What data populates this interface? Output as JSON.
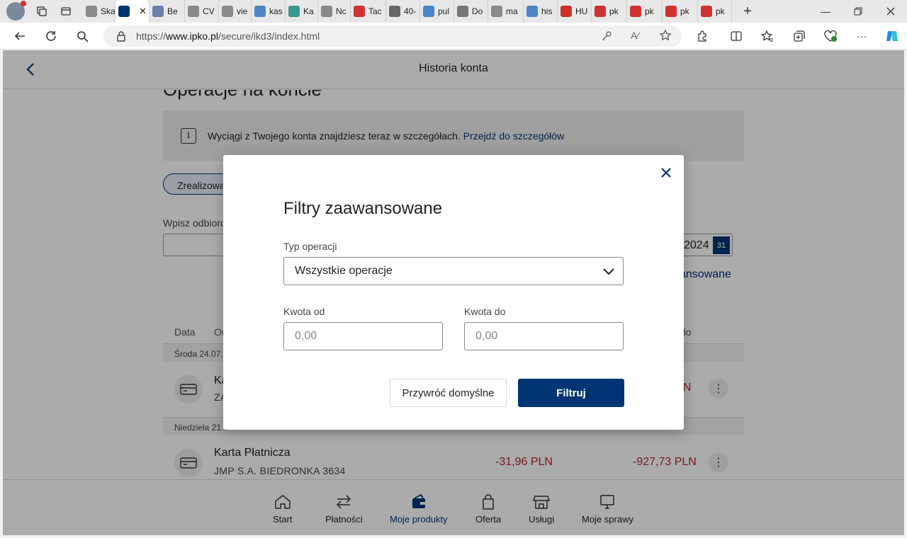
{
  "browser": {
    "tabs": [
      {
        "label": "Ska",
        "color": "#8a8a8a"
      },
      {
        "label": "",
        "color": "#003574",
        "active": true
      },
      {
        "label": "Be",
        "color": "#6a7fa8"
      },
      {
        "label": "CV",
        "color": "#8a8a8a"
      },
      {
        "label": "vie",
        "color": "#8a8a8a"
      },
      {
        "label": "kas",
        "color": "#4a86c8"
      },
      {
        "label": "Ka",
        "color": "#3a9a8a"
      },
      {
        "label": "Nc",
        "color": "#8a8a8a"
      },
      {
        "label": "Tac",
        "color": "#d0302f"
      },
      {
        "label": "40-",
        "color": "#666666"
      },
      {
        "label": "pul",
        "color": "#4a86c8"
      },
      {
        "label": "Do",
        "color": "#777777"
      },
      {
        "label": "ma",
        "color": "#8a8a8a"
      },
      {
        "label": "his",
        "color": "#4a86c8"
      },
      {
        "label": "HU",
        "color": "#c9302c"
      },
      {
        "label": "pk",
        "color": "#d0302f"
      },
      {
        "label": "pk",
        "color": "#d0302f"
      },
      {
        "label": "pk",
        "color": "#d0302f"
      },
      {
        "label": "pk",
        "color": "#d0302f"
      }
    ],
    "url_prefix": "https://",
    "url_host": "www.ipko.pl",
    "url_path": "/secure/ikd3/index.html"
  },
  "header": {
    "title": "Historia konta"
  },
  "page": {
    "heading": "Operacje na koncie",
    "info_text": "Wyciągi z Twojego konta znajdziesz teraz w szczegółach.",
    "info_link": "Przejdź do szczegółów",
    "filter_pill": "Zrealizowane",
    "search_label": "Wpisz odbiorcę",
    "date_value": "2024",
    "calendar_day": "31",
    "advanced_link": "ansowane",
    "columns": {
      "date": "Data",
      "operation": "Od",
      "balance": "do"
    }
  },
  "transactions": [
    {
      "day_label": "Środa 24.07.2",
      "title": "Ka",
      "subtitle": "ZA",
      "amount": "",
      "balance": "LN"
    },
    {
      "day_label": "Niedziela 21.0",
      "title": "Karta Płatnicza",
      "subtitle": "JMP S.A. BIEDRONKA 3634",
      "amount": "-31,96 PLN",
      "balance": "-927,73 PLN"
    }
  ],
  "bottom_nav": [
    {
      "label": "Start",
      "icon": "home-icon"
    },
    {
      "label": "Płatności",
      "icon": "transfer-arrows-icon"
    },
    {
      "label": "Moje produkty",
      "icon": "wallet-icon",
      "active": true
    },
    {
      "label": "Oferta",
      "icon": "shopping-bag-icon"
    },
    {
      "label": "Usługi",
      "icon": "store-icon"
    },
    {
      "label": "Moje sprawy",
      "icon": "monitor-icon"
    }
  ],
  "modal": {
    "title": "Filtry zaawansowane",
    "type_label": "Typ operacji",
    "type_value": "Wszystkie operacje",
    "amount_from_label": "Kwota od",
    "amount_from_placeholder": "0,00",
    "amount_to_label": "Kwota do",
    "amount_to_placeholder": "0,00",
    "reset_button": "Przywróć domyślne",
    "filter_button": "Filtruj"
  },
  "colors": {
    "brand": "#003574",
    "negative": "#b3262d"
  }
}
